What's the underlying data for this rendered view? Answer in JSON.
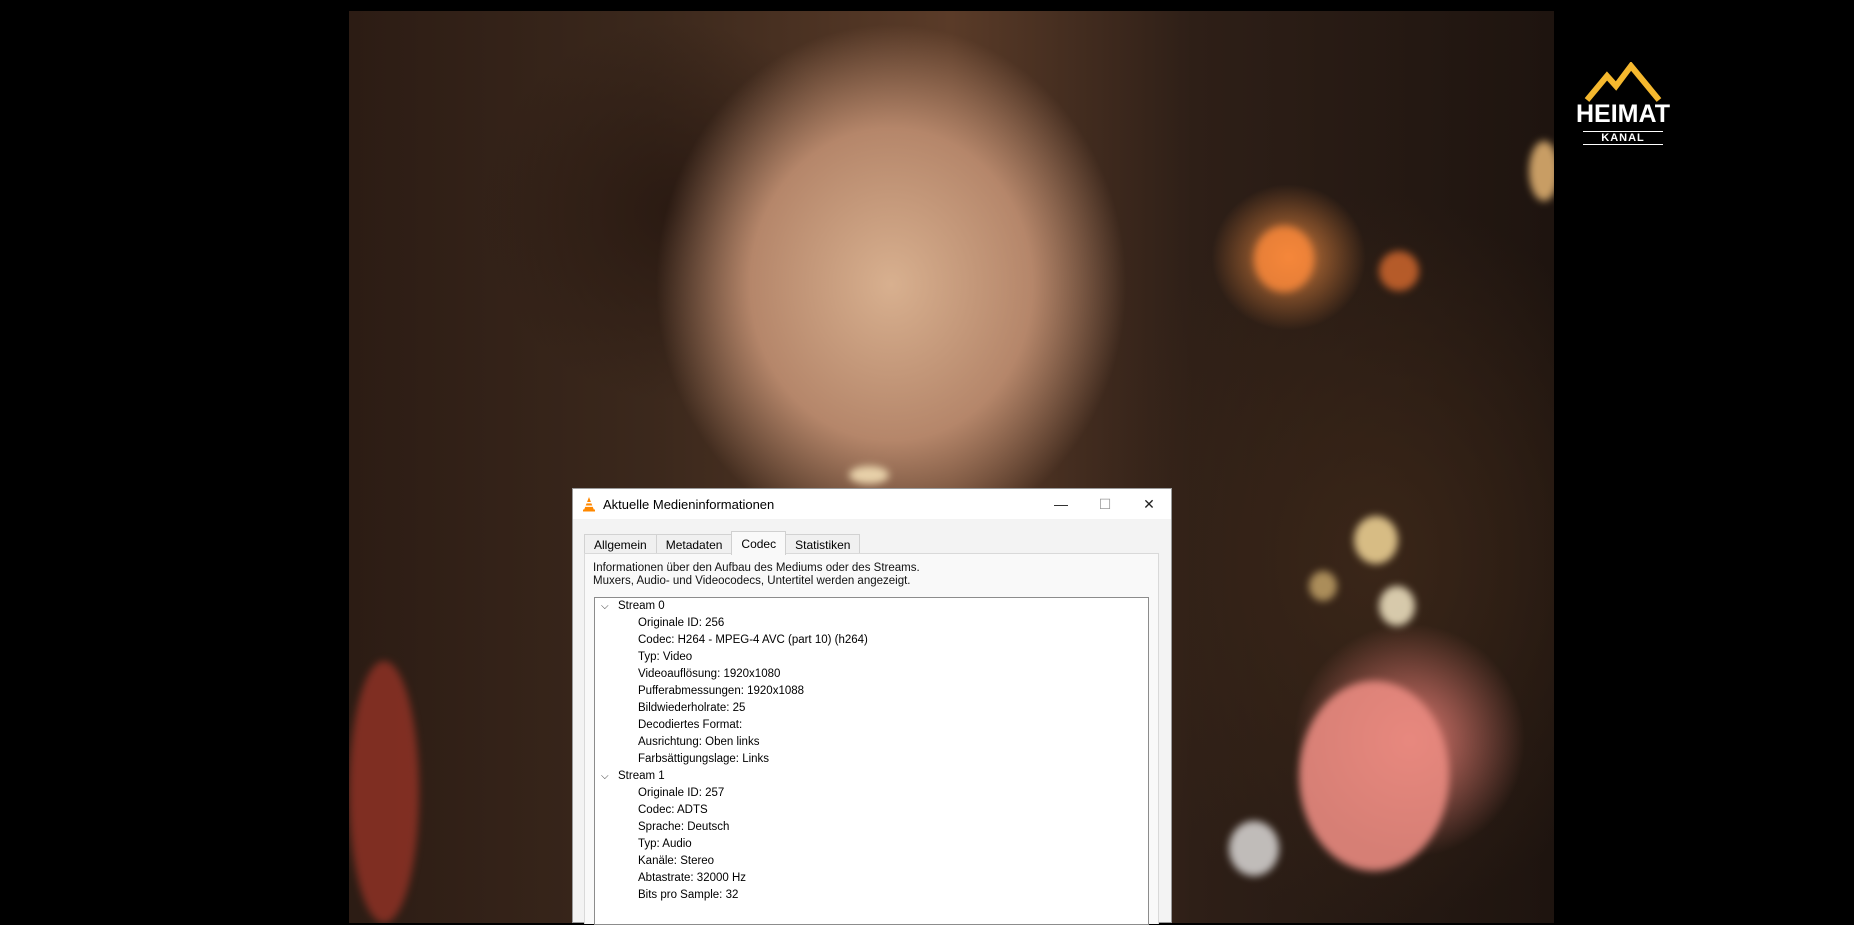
{
  "logo": {
    "line1": "HEIMAT",
    "line2": "KANAL"
  },
  "dialog": {
    "title": "Aktuelle Medieninformationen",
    "controls": {
      "minimize": "—",
      "maximize": "☐",
      "close": "✕"
    },
    "tabs": [
      "Allgemein",
      "Metadaten",
      "Codec",
      "Statistiken"
    ],
    "active_tab": "Codec",
    "description_line1": "Informationen über den Aufbau des Mediums oder des Streams.",
    "description_line2": "Muxers, Audio- und Videocodecs, Untertitel werden angezeigt.",
    "streams": [
      {
        "label": "Stream 0",
        "props": [
          "Originale ID: 256",
          "Codec: H264 - MPEG-4 AVC (part 10) (h264)",
          "Typ: Video",
          "Videoauflösung: 1920x1080",
          "Pufferabmessungen: 1920x1088",
          "Bildwiederholrate: 25",
          "Decodiertes Format:",
          "Ausrichtung: Oben links",
          "Farbsättigungslage: Links"
        ]
      },
      {
        "label": "Stream 1",
        "props": [
          "Originale ID: 257",
          "Codec: ADTS",
          "Sprache: Deutsch",
          "Typ: Audio",
          "Kanäle: Stereo",
          "Abtastrate: 32000 Hz",
          "Bits pro Sample: 32"
        ]
      }
    ]
  },
  "colors": {
    "vlc_orange": "#ff8800",
    "logo_gold": "#f5b82e"
  }
}
